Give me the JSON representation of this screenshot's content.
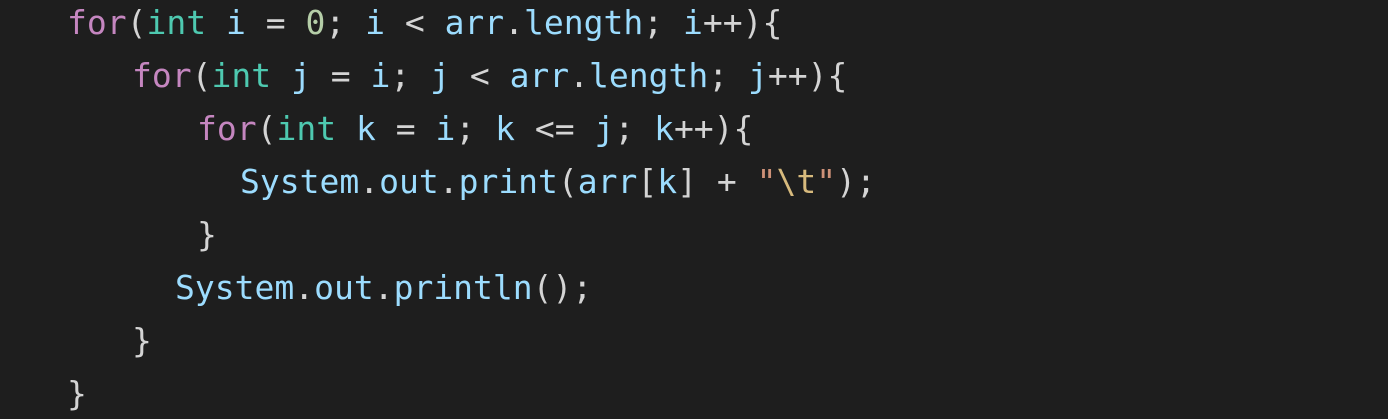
{
  "code": {
    "language": "java",
    "lines": [
      [
        {
          "t": "for",
          "c": "kw"
        },
        {
          "t": "(",
          "c": "punc"
        },
        {
          "t": "int",
          "c": "type"
        },
        {
          "t": " ",
          "c": "punc"
        },
        {
          "t": "i",
          "c": "var"
        },
        {
          "t": " = ",
          "c": "punc"
        },
        {
          "t": "0",
          "c": "num"
        },
        {
          "t": "; ",
          "c": "punc"
        },
        {
          "t": "i",
          "c": "var"
        },
        {
          "t": " < ",
          "c": "punc"
        },
        {
          "t": "arr",
          "c": "var"
        },
        {
          "t": ".",
          "c": "punc"
        },
        {
          "t": "length",
          "c": "var"
        },
        {
          "t": "; ",
          "c": "punc"
        },
        {
          "t": "i",
          "c": "var"
        },
        {
          "t": "++){",
          "c": "punc"
        }
      ],
      [
        {
          "t": "for",
          "c": "kw"
        },
        {
          "t": "(",
          "c": "punc"
        },
        {
          "t": "int",
          "c": "type"
        },
        {
          "t": " ",
          "c": "punc"
        },
        {
          "t": "j",
          "c": "var"
        },
        {
          "t": " = ",
          "c": "punc"
        },
        {
          "t": "i",
          "c": "var"
        },
        {
          "t": "; ",
          "c": "punc"
        },
        {
          "t": "j",
          "c": "var"
        },
        {
          "t": " < ",
          "c": "punc"
        },
        {
          "t": "arr",
          "c": "var"
        },
        {
          "t": ".",
          "c": "punc"
        },
        {
          "t": "length",
          "c": "var"
        },
        {
          "t": "; ",
          "c": "punc"
        },
        {
          "t": "j",
          "c": "var"
        },
        {
          "t": "++){",
          "c": "punc"
        }
      ],
      [
        {
          "t": "for",
          "c": "kw"
        },
        {
          "t": "(",
          "c": "punc"
        },
        {
          "t": "int",
          "c": "type"
        },
        {
          "t": " ",
          "c": "punc"
        },
        {
          "t": "k",
          "c": "var"
        },
        {
          "t": " = ",
          "c": "punc"
        },
        {
          "t": "i",
          "c": "var"
        },
        {
          "t": "; ",
          "c": "punc"
        },
        {
          "t": "k",
          "c": "var"
        },
        {
          "t": " <= ",
          "c": "punc"
        },
        {
          "t": "j",
          "c": "var"
        },
        {
          "t": "; ",
          "c": "punc"
        },
        {
          "t": "k",
          "c": "var"
        },
        {
          "t": "++){",
          "c": "punc"
        }
      ],
      [
        {
          "t": "System",
          "c": "var"
        },
        {
          "t": ".",
          "c": "punc"
        },
        {
          "t": "out",
          "c": "var"
        },
        {
          "t": ".",
          "c": "punc"
        },
        {
          "t": "print",
          "c": "var"
        },
        {
          "t": "(",
          "c": "punc"
        },
        {
          "t": "arr",
          "c": "var"
        },
        {
          "t": "[",
          "c": "punc"
        },
        {
          "t": "k",
          "c": "var"
        },
        {
          "t": "] + ",
          "c": "punc"
        },
        {
          "t": "\"",
          "c": "str"
        },
        {
          "t": "\\t",
          "c": "esc"
        },
        {
          "t": "\"",
          "c": "str"
        },
        {
          "t": ");",
          "c": "punc"
        }
      ],
      [
        {
          "t": "}",
          "c": "punc"
        }
      ],
      [
        {
          "t": "System",
          "c": "var"
        },
        {
          "t": ".",
          "c": "punc"
        },
        {
          "t": "out",
          "c": "var"
        },
        {
          "t": ".",
          "c": "punc"
        },
        {
          "t": "println",
          "c": "var"
        },
        {
          "t": "();",
          "c": "punc"
        }
      ],
      [
        {
          "t": "}",
          "c": "punc"
        }
      ],
      [
        {
          "t": "}",
          "c": "punc"
        }
      ]
    ]
  },
  "theme": {
    "background": "#1e1e1e",
    "keyword": "#c586c0",
    "type": "#4ec9b0",
    "variable": "#9cdcfe",
    "number": "#b5cea8",
    "string": "#ce9178",
    "escape": "#d7ba7d",
    "punctuation": "#d4d4d4"
  }
}
